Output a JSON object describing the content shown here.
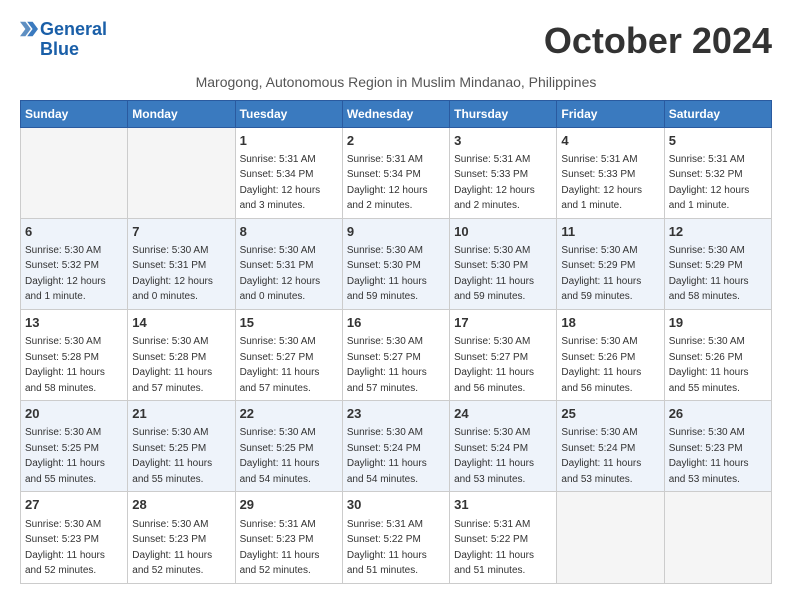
{
  "logo": {
    "line1": "General",
    "line2": "Blue"
  },
  "title": "October 2024",
  "location": "Marogong, Autonomous Region in Muslim Mindanao, Philippines",
  "headers": [
    "Sunday",
    "Monday",
    "Tuesday",
    "Wednesday",
    "Thursday",
    "Friday",
    "Saturday"
  ],
  "weeks": [
    [
      {
        "day": "",
        "info": ""
      },
      {
        "day": "",
        "info": ""
      },
      {
        "day": "1",
        "info": "Sunrise: 5:31 AM\nSunset: 5:34 PM\nDaylight: 12 hours and 3 minutes."
      },
      {
        "day": "2",
        "info": "Sunrise: 5:31 AM\nSunset: 5:34 PM\nDaylight: 12 hours and 2 minutes."
      },
      {
        "day": "3",
        "info": "Sunrise: 5:31 AM\nSunset: 5:33 PM\nDaylight: 12 hours and 2 minutes."
      },
      {
        "day": "4",
        "info": "Sunrise: 5:31 AM\nSunset: 5:33 PM\nDaylight: 12 hours and 1 minute."
      },
      {
        "day": "5",
        "info": "Sunrise: 5:31 AM\nSunset: 5:32 PM\nDaylight: 12 hours and 1 minute."
      }
    ],
    [
      {
        "day": "6",
        "info": "Sunrise: 5:30 AM\nSunset: 5:32 PM\nDaylight: 12 hours and 1 minute."
      },
      {
        "day": "7",
        "info": "Sunrise: 5:30 AM\nSunset: 5:31 PM\nDaylight: 12 hours and 0 minutes."
      },
      {
        "day": "8",
        "info": "Sunrise: 5:30 AM\nSunset: 5:31 PM\nDaylight: 12 hours and 0 minutes."
      },
      {
        "day": "9",
        "info": "Sunrise: 5:30 AM\nSunset: 5:30 PM\nDaylight: 11 hours and 59 minutes."
      },
      {
        "day": "10",
        "info": "Sunrise: 5:30 AM\nSunset: 5:30 PM\nDaylight: 11 hours and 59 minutes."
      },
      {
        "day": "11",
        "info": "Sunrise: 5:30 AM\nSunset: 5:29 PM\nDaylight: 11 hours and 59 minutes."
      },
      {
        "day": "12",
        "info": "Sunrise: 5:30 AM\nSunset: 5:29 PM\nDaylight: 11 hours and 58 minutes."
      }
    ],
    [
      {
        "day": "13",
        "info": "Sunrise: 5:30 AM\nSunset: 5:28 PM\nDaylight: 11 hours and 58 minutes."
      },
      {
        "day": "14",
        "info": "Sunrise: 5:30 AM\nSunset: 5:28 PM\nDaylight: 11 hours and 57 minutes."
      },
      {
        "day": "15",
        "info": "Sunrise: 5:30 AM\nSunset: 5:27 PM\nDaylight: 11 hours and 57 minutes."
      },
      {
        "day": "16",
        "info": "Sunrise: 5:30 AM\nSunset: 5:27 PM\nDaylight: 11 hours and 57 minutes."
      },
      {
        "day": "17",
        "info": "Sunrise: 5:30 AM\nSunset: 5:27 PM\nDaylight: 11 hours and 56 minutes."
      },
      {
        "day": "18",
        "info": "Sunrise: 5:30 AM\nSunset: 5:26 PM\nDaylight: 11 hours and 56 minutes."
      },
      {
        "day": "19",
        "info": "Sunrise: 5:30 AM\nSunset: 5:26 PM\nDaylight: 11 hours and 55 minutes."
      }
    ],
    [
      {
        "day": "20",
        "info": "Sunrise: 5:30 AM\nSunset: 5:25 PM\nDaylight: 11 hours and 55 minutes."
      },
      {
        "day": "21",
        "info": "Sunrise: 5:30 AM\nSunset: 5:25 PM\nDaylight: 11 hours and 55 minutes."
      },
      {
        "day": "22",
        "info": "Sunrise: 5:30 AM\nSunset: 5:25 PM\nDaylight: 11 hours and 54 minutes."
      },
      {
        "day": "23",
        "info": "Sunrise: 5:30 AM\nSunset: 5:24 PM\nDaylight: 11 hours and 54 minutes."
      },
      {
        "day": "24",
        "info": "Sunrise: 5:30 AM\nSunset: 5:24 PM\nDaylight: 11 hours and 53 minutes."
      },
      {
        "day": "25",
        "info": "Sunrise: 5:30 AM\nSunset: 5:24 PM\nDaylight: 11 hours and 53 minutes."
      },
      {
        "day": "26",
        "info": "Sunrise: 5:30 AM\nSunset: 5:23 PM\nDaylight: 11 hours and 53 minutes."
      }
    ],
    [
      {
        "day": "27",
        "info": "Sunrise: 5:30 AM\nSunset: 5:23 PM\nDaylight: 11 hours and 52 minutes."
      },
      {
        "day": "28",
        "info": "Sunrise: 5:30 AM\nSunset: 5:23 PM\nDaylight: 11 hours and 52 minutes."
      },
      {
        "day": "29",
        "info": "Sunrise: 5:31 AM\nSunset: 5:23 PM\nDaylight: 11 hours and 52 minutes."
      },
      {
        "day": "30",
        "info": "Sunrise: 5:31 AM\nSunset: 5:22 PM\nDaylight: 11 hours and 51 minutes."
      },
      {
        "day": "31",
        "info": "Sunrise: 5:31 AM\nSunset: 5:22 PM\nDaylight: 11 hours and 51 minutes."
      },
      {
        "day": "",
        "info": ""
      },
      {
        "day": "",
        "info": ""
      }
    ]
  ]
}
